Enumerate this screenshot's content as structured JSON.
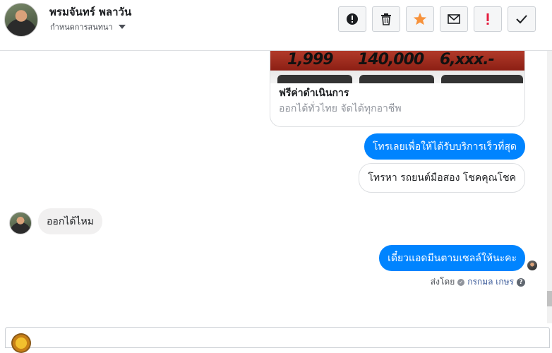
{
  "header": {
    "contact_name": "พรมจันทร์ พลาวัน",
    "subtitle": "กำหนดการสนทนา"
  },
  "toolbar": {
    "buttons": [
      {
        "name": "spam-icon",
        "glyph": "!",
        "color": "#1c1e21"
      },
      {
        "name": "trash-icon",
        "glyph": "🗑",
        "color": "#1c1e21"
      },
      {
        "name": "star-icon",
        "glyph": "★",
        "color": "#f7923b"
      },
      {
        "name": "mail-icon",
        "glyph": "✉",
        "color": "#1c1e21"
      },
      {
        "name": "flag-icon",
        "glyph": "!",
        "color": "#e41e3f"
      },
      {
        "name": "check-icon",
        "glyph": "✓",
        "color": "#1c1e21"
      }
    ]
  },
  "card": {
    "banner_values": [
      "1,999",
      "140,000",
      "6,xxx.-"
    ],
    "title": "ฟรีค่าดำเนินการ",
    "subtitle": "ออกได้ทั่วไทย จัดได้ทุกอาชีพ"
  },
  "messages": {
    "m1": "โทรเลยเพื่อให้ได้รับบริการเร็วที่สุด",
    "m2": "โทรหา รถยนต์มือสอง โชคคุณโชค",
    "m3": "ออกได้ไหม",
    "m4": "เดี๋ยวแอดมีนตามเซลล์ให้นะคะ"
  },
  "sent_by": {
    "label": "ส่งโดย",
    "agent": "กรกมล เกษร"
  },
  "colors": {
    "accent": "#0084ff",
    "star": "#f7923b",
    "flag": "#e41e3f"
  }
}
